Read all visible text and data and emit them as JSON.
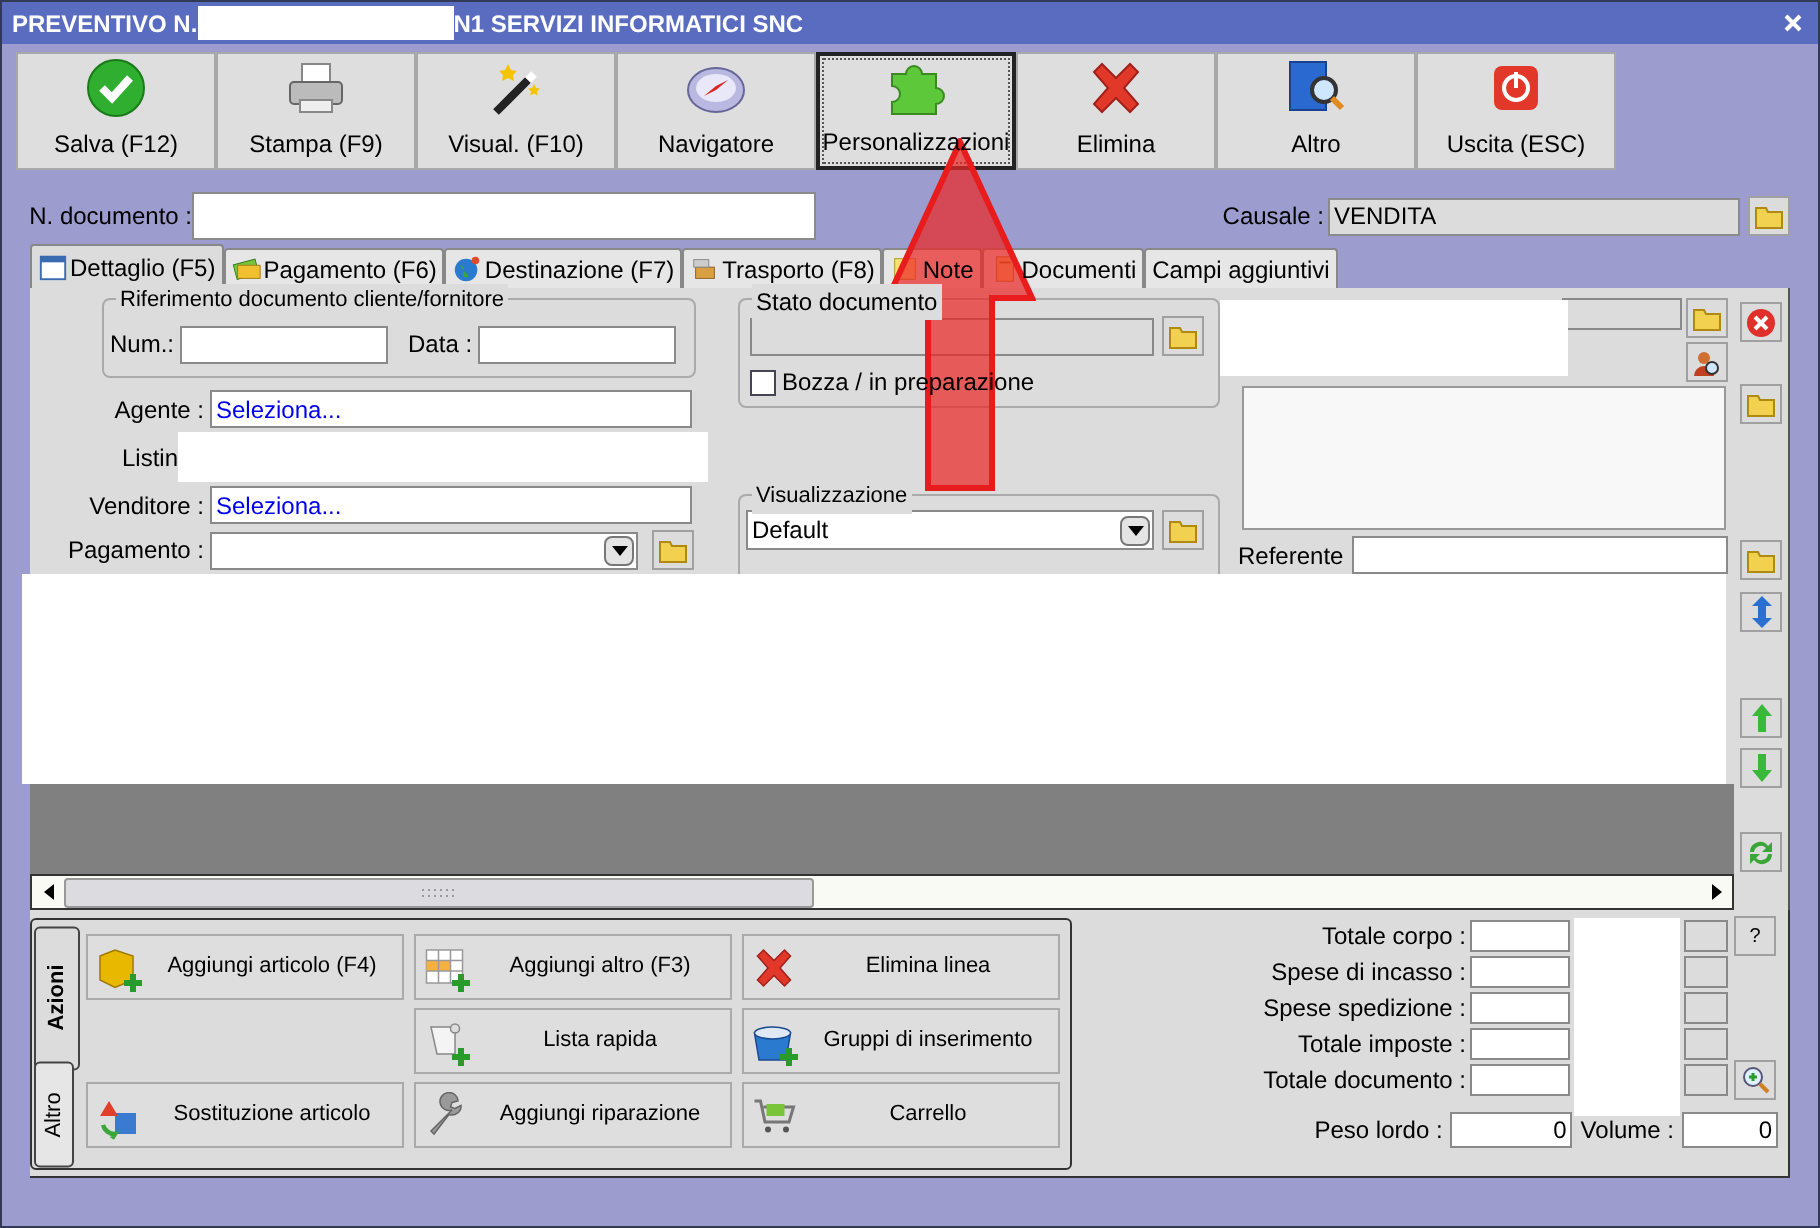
{
  "window": {
    "title_start": "PREVENTIVO N.",
    "title_end": "N1 SERVIZI INFORMATICI SNC"
  },
  "toolbar": [
    {
      "label": "Salva (F12)",
      "kind": "check",
      "selected": false
    },
    {
      "label": "Stampa (F9)",
      "kind": "printer",
      "selected": false
    },
    {
      "label": "Visual. (F10)",
      "kind": "wand",
      "selected": false
    },
    {
      "label": "Navigatore",
      "kind": "compass",
      "selected": false
    },
    {
      "label": "Personalizzazioni",
      "kind": "puzzle",
      "selected": true
    },
    {
      "label": "Elimina",
      "kind": "cross",
      "selected": false
    },
    {
      "label": "Altro",
      "kind": "book",
      "selected": false
    },
    {
      "label": "Uscita (ESC)",
      "kind": "power",
      "selected": false
    }
  ],
  "document_number": {
    "label": "N. documento :"
  },
  "causale": {
    "label": "Causale :",
    "value": "VENDITA"
  },
  "tabs": [
    {
      "label": "Dettaglio (F5)",
      "kind": "calendar",
      "selected": true
    },
    {
      "label": "Pagamento (F6)",
      "kind": "money",
      "selected": false
    },
    {
      "label": "Destinazione (F7)",
      "kind": "globe",
      "selected": false
    },
    {
      "label": "Trasporto (F8)",
      "kind": "truck",
      "selected": false
    },
    {
      "label": "Note",
      "kind": "note",
      "selected": false
    },
    {
      "label": "Documenti",
      "kind": "document",
      "selected": false
    },
    {
      "label": "Campi aggiuntivi",
      "selected": false
    }
  ],
  "reference": {
    "legend": "Riferimento documento cliente/fornitore",
    "num_label": "Num.:",
    "date_label": "Data :"
  },
  "agente": {
    "label": "Agente :",
    "value": "Seleziona..."
  },
  "listino": {
    "label": "Listin"
  },
  "venditore": {
    "label": "Venditore :",
    "value": "Seleziona..."
  },
  "pagamento": {
    "label": "Pagamento :"
  },
  "stato": {
    "legend": "Stato documento",
    "draft_label": "Bozza / in preparazione",
    "draft_checked": false
  },
  "visualizzazione": {
    "legend": "Visualizzazione",
    "value": "Default"
  },
  "referente": {
    "label": "Referente"
  },
  "action_tabs": [
    {
      "label": "Azioni",
      "selected": true
    },
    {
      "label": "Altro",
      "selected": false
    }
  ],
  "action_columns": [
    [
      {
        "label": "Aggiungi articolo (F4)",
        "kind": "box-plus"
      },
      {
        "label": "Sostituzione articolo",
        "kind": "swap"
      }
    ],
    [
      {
        "label": "Aggiungi altro (F3)",
        "kind": "grid-plus"
      },
      {
        "label": "Lista rapida",
        "kind": "scroll-plus"
      },
      {
        "label": "Aggiungi riparazione",
        "kind": "wrench"
      }
    ],
    [
      {
        "label": "Elimina linea",
        "kind": "cross"
      },
      {
        "label": "Gruppi di inserimento",
        "kind": "bucket-plus"
      },
      {
        "label": "Carrello",
        "kind": "cart"
      }
    ]
  ],
  "totals": [
    {
      "label": "Totale corpo :",
      "button": "?"
    },
    {
      "label": "Spese di incasso :"
    },
    {
      "label": "Spese spedizione :"
    },
    {
      "label": "Totale imposte :"
    },
    {
      "label": "Totale documento :"
    }
  ],
  "weight": {
    "label": "Peso lordo :",
    "value": "0"
  },
  "volume": {
    "label": "Volume :",
    "value": "0"
  }
}
